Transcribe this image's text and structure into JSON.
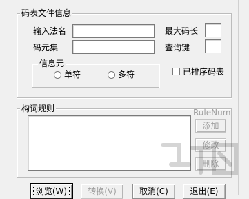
{
  "file_info_group": {
    "title": "码表文件信息",
    "input_method_label": "输入法名",
    "input_method_value": "",
    "code_set_label": "码元集",
    "code_set_value": "",
    "max_code_len_label": "最大码长",
    "max_code_len_value": "",
    "query_key_label": "查询键",
    "query_key_value": "",
    "sorted_checkbox_label": "已排序码表",
    "sorted_checked": false
  },
  "info_unit_group": {
    "title": "信息元",
    "single_label": "单符",
    "multi_label": "多符",
    "selected": "none"
  },
  "word_rule_group": {
    "title": "构词规则",
    "rulenum_label": "RuleNum",
    "rules_text": "",
    "add_label": "添加",
    "modify_label": "修改",
    "delete_label": "删除"
  },
  "bottom_buttons": {
    "browse_label": "浏览(W)",
    "convert_label": "转换(V)",
    "cancel_label": "取消(C)",
    "exit_label": "退出(E)"
  },
  "icons": {
    "watermark": "watermark-logo-icon"
  },
  "colors": {
    "dialog_bg": "#f0f0f0",
    "disabled_text": "#a0a0a0",
    "border": "#bcbcbc"
  }
}
